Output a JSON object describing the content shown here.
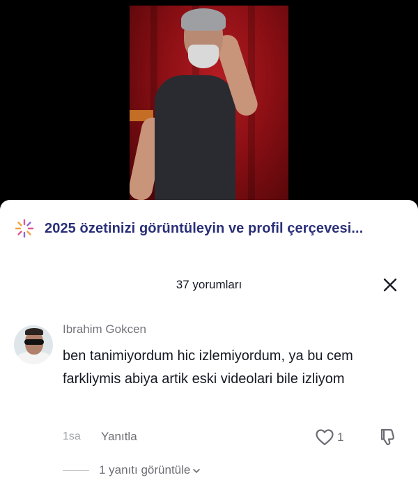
{
  "video": {
    "description_colors": {
      "curtain": "#8a0f14",
      "shirt": "#2a2b30"
    }
  },
  "banner": {
    "icon": "sparkle-icon",
    "text": "2025 özetinizi görüntüleyin ve profil çerçevesi...",
    "color": "#2a2f78"
  },
  "comments_header": {
    "count_label": "37 yorumları",
    "close_icon": "close-icon"
  },
  "comment": {
    "username": "Ibrahim Gokcen",
    "text": "ben tanimiyordum hic izlemiyordum, ya bu cem farkliymis abiya artik eski videolari bile izliyom",
    "time": "1sa",
    "reply_label": "Yanıtla",
    "like_count": "1",
    "view_replies_label": "1 yanıtı görüntüle"
  }
}
